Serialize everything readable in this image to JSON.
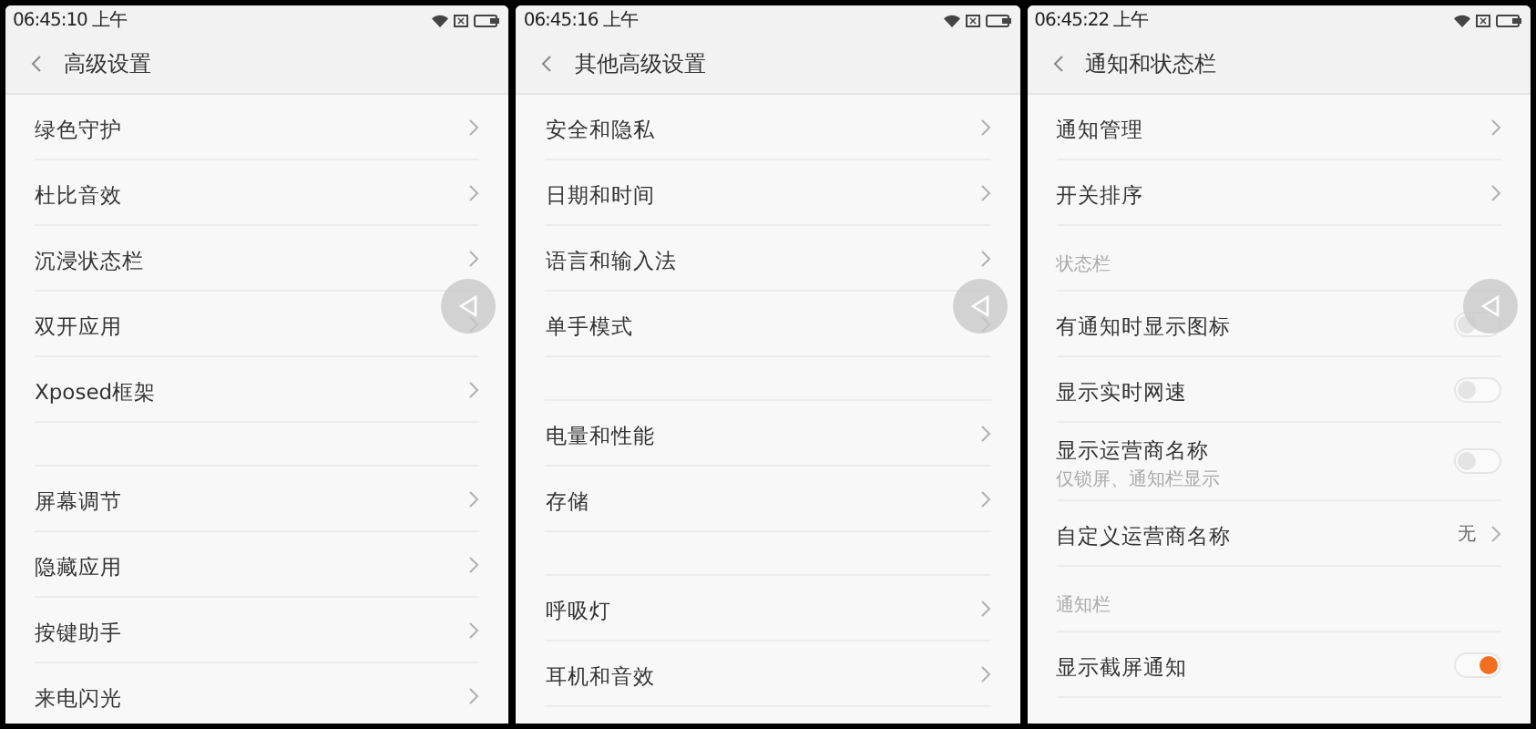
{
  "panels": [
    {
      "status_bar": {
        "time": "06:45:10 上午"
      },
      "header": {
        "title": "高级设置"
      },
      "items": [
        {
          "kind": "link",
          "label": "绿色守护"
        },
        {
          "kind": "link",
          "label": "杜比音效"
        },
        {
          "kind": "link",
          "label": "沉浸状态栏"
        },
        {
          "kind": "link",
          "label": "双开应用"
        },
        {
          "kind": "link",
          "label": "Xposed框架"
        },
        {
          "kind": "spacer"
        },
        {
          "kind": "link",
          "label": "屏幕调节"
        },
        {
          "kind": "link",
          "label": "隐藏应用"
        },
        {
          "kind": "link",
          "label": "按键助手"
        },
        {
          "kind": "link",
          "label": "来电闪光"
        }
      ]
    },
    {
      "status_bar": {
        "time": "06:45:16 上午"
      },
      "header": {
        "title": "其他高级设置"
      },
      "items": [
        {
          "kind": "link",
          "label": "安全和隐私"
        },
        {
          "kind": "link",
          "label": "日期和时间"
        },
        {
          "kind": "link",
          "label": "语言和输入法"
        },
        {
          "kind": "link",
          "label": "单手模式"
        },
        {
          "kind": "spacer"
        },
        {
          "kind": "link",
          "label": "电量和性能"
        },
        {
          "kind": "link",
          "label": "存储"
        },
        {
          "kind": "spacer"
        },
        {
          "kind": "link",
          "label": "呼吸灯"
        },
        {
          "kind": "link",
          "label": "耳机和音效"
        }
      ]
    },
    {
      "status_bar": {
        "time": "06:45:22 上午"
      },
      "header": {
        "title": "通知和状态栏"
      },
      "items": [
        {
          "kind": "link",
          "label": "通知管理"
        },
        {
          "kind": "link",
          "label": "开关排序"
        },
        {
          "kind": "section",
          "label": "状态栏"
        },
        {
          "kind": "toggle",
          "label": "有通知时显示图标",
          "on": false
        },
        {
          "kind": "toggle",
          "label": "显示实时网速",
          "on": false
        },
        {
          "kind": "toggle",
          "label": "显示运营商名称",
          "subtitle": "仅锁屏、通知栏显示",
          "on": false
        },
        {
          "kind": "value",
          "label": "自定义运营商名称",
          "value": "无"
        },
        {
          "kind": "section",
          "label": "通知栏"
        },
        {
          "kind": "toggle",
          "label": "显示截屏通知",
          "on": true
        }
      ]
    }
  ]
}
